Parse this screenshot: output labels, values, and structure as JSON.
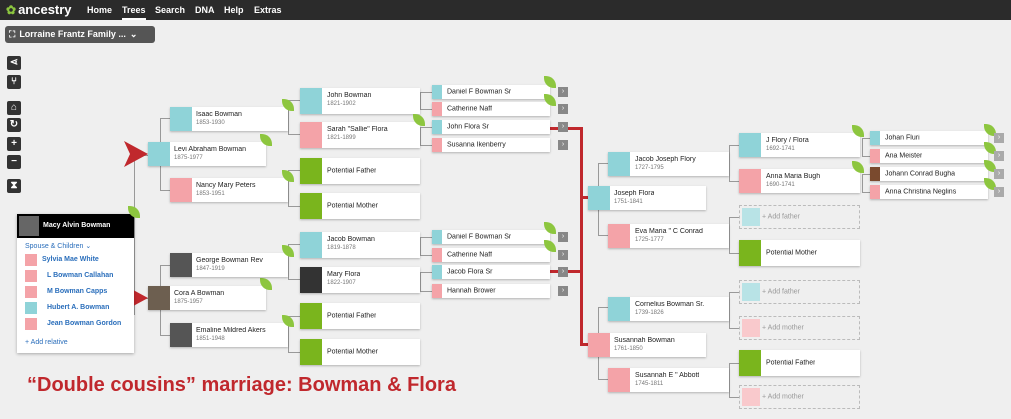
{
  "header": {
    "logo": "ancestry",
    "nav": [
      "Home",
      "Trees",
      "Search",
      "DNA",
      "Help",
      "Extras"
    ],
    "active_nav": "Trees"
  },
  "tree_selector": {
    "label": "Lorraine Frantz Family ..."
  },
  "tools": [
    "pedigree-view-icon",
    "family-view-icon",
    "home-icon",
    "refresh-icon",
    "zoom-in-icon",
    "zoom-out-icon",
    "hourglass-icon"
  ],
  "home_person": {
    "name": "Macy Alvin Bowman",
    "spouse_children_label": "Spouse & Children",
    "spouse": "Sylvia Mae White",
    "children": [
      "L Bowman Callahan",
      "M Bowman Capps",
      "Hubert A. Bowman",
      "Jean Bowman Gordon"
    ],
    "add_relative": "Add relative"
  },
  "people": {
    "levi": {
      "name": "Levi Abraham Bowman",
      "dates": "1875-1977"
    },
    "cora": {
      "name": "Cora A Bowman",
      "dates": "1875-1957"
    },
    "isaac": {
      "name": "Isaac Bowman",
      "dates": "1853-1930"
    },
    "nancy": {
      "name": "Nancy Mary Peters",
      "dates": "1853-1951"
    },
    "george": {
      "name": "George Bowman Rev",
      "dates": "1847-1919"
    },
    "emaline": {
      "name": "Emaline Mildred Akers",
      "dates": "1851-1948"
    },
    "john_b": {
      "name": "John Bowman",
      "dates": "1821-1902"
    },
    "sarah": {
      "name": "Sarah \"Sallie\" Flora",
      "dates": "1821-1899"
    },
    "pf1": {
      "name": "Potential Father"
    },
    "pm1": {
      "name": "Potential Mother"
    },
    "jacob_b": {
      "name": "Jacob Bowman",
      "dates": "1819-1878"
    },
    "mary_f": {
      "name": "Mary Flora",
      "dates": "1822-1907"
    },
    "pf2": {
      "name": "Potential Father"
    },
    "pm2": {
      "name": "Potential Mother"
    },
    "daniel1": {
      "name": "Daniel F Bowman Sr"
    },
    "catherine1": {
      "name": "Catherine Naff"
    },
    "john_flora": {
      "name": "John Flora Sr"
    },
    "susanna_ik": {
      "name": "Susanna Ikenberry"
    },
    "daniel2": {
      "name": "Daniel F Bowman Sr"
    },
    "catherine2": {
      "name": "Catherine Naff"
    },
    "jacob_flora": {
      "name": "Jacob Flora Sr"
    },
    "hannah": {
      "name": "Hannah Brower"
    },
    "joseph": {
      "name": "Joseph Flora",
      "dates": "1751-1841"
    },
    "susannah_b": {
      "name": "Susannah Bowman",
      "dates": "1761-1850"
    },
    "jacob_joseph": {
      "name": "Jacob Joseph Flory",
      "dates": "1727-1795"
    },
    "eva": {
      "name": "Eva Maria \" C Conrad",
      "dates": "1725-1777"
    },
    "cornelius": {
      "name": "Cornelius Bowman Sr.",
      "dates": "1739-1826"
    },
    "susannah_e": {
      "name": "Susannah E \" Abbott",
      "dates": "1745-1811"
    },
    "j_flory": {
      "name": "J Flory / Flora",
      "dates": "1692-1741"
    },
    "anna_bugh": {
      "name": "Anna Maria Bugh",
      "dates": "1690-1741"
    },
    "pf3": {
      "name": "Potential Mother"
    },
    "pf4": {
      "name": "Potential Father"
    },
    "johan_f": {
      "name": "Johan Fluri"
    },
    "ana_m": {
      "name": "Ana Meister"
    },
    "johann_cb": {
      "name": "Johann Conrad Bugha"
    },
    "anna_cn": {
      "name": "Anna Christina Neglins"
    }
  },
  "placeholders": {
    "add_father": "Add father",
    "add_mother": "Add mother"
  },
  "caption": "“Double cousins” marriage: Bowman & Flora",
  "colors": {
    "male": "#8fd3d8",
    "female": "#f4a3a8",
    "potential": "#7ab51d",
    "accent": "#c0282d",
    "hint": "#8dc63f"
  }
}
